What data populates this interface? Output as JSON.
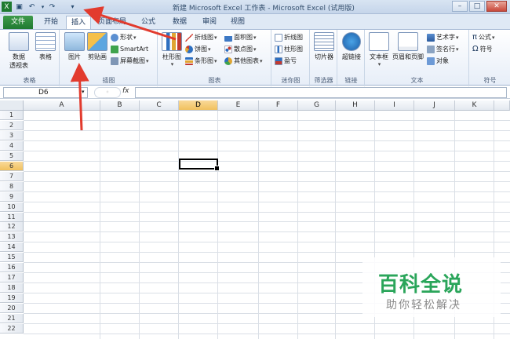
{
  "window": {
    "title": "新建 Microsoft Excel 工作表 - Microsoft Excel (试用版)",
    "controls": [
      "–",
      "□",
      "✕"
    ]
  },
  "tabs": [
    {
      "label": "文件",
      "kind": "file"
    },
    {
      "label": "开始"
    },
    {
      "label": "插入",
      "active": true
    },
    {
      "label": "页面布局"
    },
    {
      "label": "公式"
    },
    {
      "label": "数据"
    },
    {
      "label": "审阅"
    },
    {
      "label": "视图"
    }
  ],
  "ribbon": {
    "groups": {
      "tables": {
        "label": "表格",
        "pivot": "数据\n透视表",
        "pivot_l1": "数据",
        "pivot_l2": "透视表",
        "table": "表格"
      },
      "illustrations": {
        "label": "插图",
        "picture": "图片",
        "clipart": "剪贴画",
        "shapes": "形状",
        "smartart": "SmartArt",
        "screenshot": "屏幕截图"
      },
      "charts": {
        "label": "图表",
        "column": "柱形图",
        "line": "折线图",
        "pie": "饼图",
        "bar": "条形图",
        "area": "面积图",
        "scatter": "散点图",
        "other": "其他图表"
      },
      "sparklines": {
        "label": "迷你图",
        "line": "折线图",
        "column": "柱形图",
        "winloss": "盈亏"
      },
      "filter": {
        "label": "筛选器",
        "slicer": "切片器"
      },
      "links": {
        "label": "链接",
        "hyperlink": "超链接"
      },
      "text": {
        "label": "文本",
        "textbox": "文本框",
        "headerfooter": "页眉和页脚",
        "wordart": "艺术字",
        "signature": "签名行",
        "object": "对象"
      },
      "symbols": {
        "label": "符号",
        "equation": "公式",
        "symbol": "符号"
      }
    }
  },
  "formula_bar": {
    "name_box": "D6",
    "fx": "fx",
    "value": ""
  },
  "grid": {
    "columns": [
      "A",
      "B",
      "C",
      "D",
      "E",
      "F",
      "G",
      "H",
      "I",
      "J",
      "K"
    ],
    "rows": [
      "1",
      "2",
      "3",
      "4",
      "5",
      "6",
      "7",
      "8",
      "9",
      "10",
      "11",
      "12",
      "13",
      "14",
      "15",
      "16",
      "17",
      "18",
      "19",
      "20",
      "21",
      "22"
    ],
    "selected_cell": "D6",
    "selected_column": "D",
    "selected_row": "6"
  },
  "watermark": {
    "logo": "百科全说",
    "sub": "助你轻松解决"
  },
  "colors": {
    "accent_red": "#e23b2e",
    "file_tab": "#2a8a3b",
    "selection": "#f3c766",
    "watermark_green": "#2aa55a"
  }
}
